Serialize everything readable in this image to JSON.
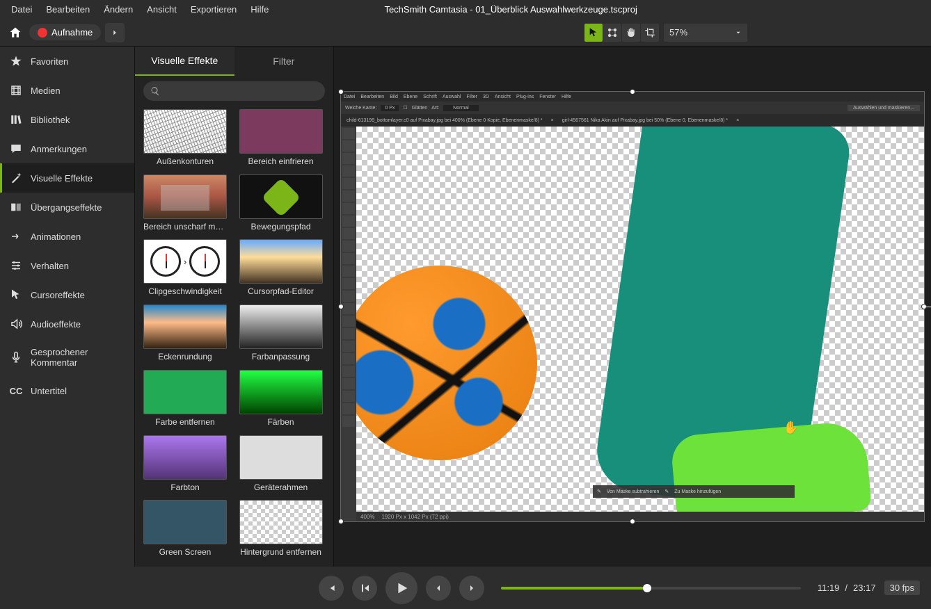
{
  "appTitle": "TechSmith Camtasia - 01_Überblick Auswahlwerkzeuge.tscproj",
  "menu": [
    "Datei",
    "Bearbeiten",
    "Ändern",
    "Ansicht",
    "Exportieren",
    "Hilfe"
  ],
  "record": {
    "label": "Aufnahme"
  },
  "zoom": {
    "value": "57%"
  },
  "sidebar": [
    {
      "id": "favorites",
      "label": "Favoriten"
    },
    {
      "id": "media",
      "label": "Medien"
    },
    {
      "id": "library",
      "label": "Bibliothek"
    },
    {
      "id": "annotations",
      "label": "Anmerkungen"
    },
    {
      "id": "visualeffects",
      "label": "Visuelle Effekte"
    },
    {
      "id": "transitions",
      "label": "Übergangseffekte"
    },
    {
      "id": "animations",
      "label": "Animationen"
    },
    {
      "id": "behaviors",
      "label": "Verhalten"
    },
    {
      "id": "cursoreffects",
      "label": "Cursoreffekte"
    },
    {
      "id": "audioeffects",
      "label": "Audioeffekte"
    },
    {
      "id": "voice",
      "label": "Gesprochener Kommentar"
    },
    {
      "id": "captions",
      "label": "Untertitel"
    }
  ],
  "activeSidebar": "visualeffects",
  "tabs": {
    "effects": "Visuelle Effekte",
    "filter": "Filter"
  },
  "search": {
    "placeholder": ""
  },
  "effects": [
    {
      "label": "Außenkonturen",
      "cls": "th-sketch"
    },
    {
      "label": "Bereich einfrieren",
      "cls": "th-freeze"
    },
    {
      "label": "Bereich unscharf ma...",
      "cls": "th-blur"
    },
    {
      "label": "Bewegungspfad",
      "cls": "th-motion"
    },
    {
      "label": "Clipgeschwindigkeit",
      "cls": "th-clocks"
    },
    {
      "label": "Cursorpfad-Editor",
      "cls": "th-mtn"
    },
    {
      "label": "Eckenrundung",
      "cls": "th-mtn2"
    },
    {
      "label": "Farbanpassung",
      "cls": "th-bw"
    },
    {
      "label": "Farbe entfernen",
      "cls": "th-person"
    },
    {
      "label": "Färben",
      "cls": "th-green"
    },
    {
      "label": "Farbton",
      "cls": "th-purple"
    },
    {
      "label": "Geräterahmen",
      "cls": "th-device"
    },
    {
      "label": "Green Screen",
      "cls": "th-person2"
    },
    {
      "label": "Hintergrund entfernen",
      "cls": "th-check"
    }
  ],
  "psMenu": [
    "Datei",
    "Bearbeiten",
    "Bild",
    "Ebene",
    "Schrift",
    "Auswahl",
    "Filter",
    "3D",
    "Ansicht",
    "Plug-ins",
    "Fenster",
    "Hilfe"
  ],
  "psOpts": {
    "edge": "Weiche Kante:",
    "edgeVal": "0 Px",
    "smooth": "Glätten",
    "art": "Art:",
    "artVal": "Normal",
    "btn": "Auswählen und maskieren..."
  },
  "psTabs": [
    "child-613199_bottomlayer.c0 auf Pixabay.jpg bei 400% (Ebene 0 Kopie, Ebenenmaske/8) *",
    "girl-4567561 Nika Akin auf Pixabay.jpg bei 50% (Ebene 0, Ebenenmaske/8) *"
  ],
  "psStatus": {
    "zoom": "400%",
    "dims": "1920 Px x 1042 Px (72 ppi)"
  },
  "psBottomBar": {
    "a": "Von Maske subtrahieren",
    "b": "Zu Maske hinzufügen"
  },
  "player": {
    "current": "11:19",
    "total": "23:17",
    "fps": "30 fps",
    "seekPct": 48.7
  }
}
